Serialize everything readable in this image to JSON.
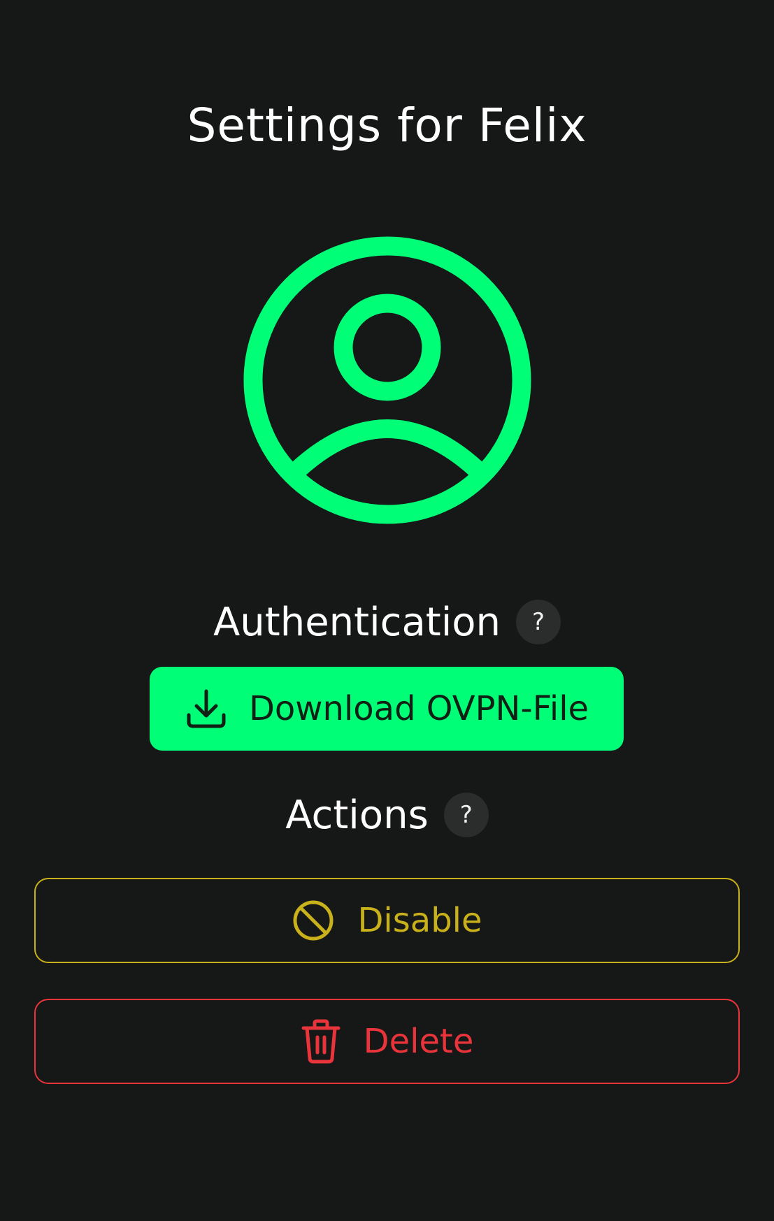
{
  "header": {
    "title": "Settings for Felix"
  },
  "avatar": {
    "icon": "user-circle-icon",
    "color": "#00ff77"
  },
  "authentication": {
    "heading": "Authentication",
    "help_label": "?",
    "download_button_label": "Download OVPN-File",
    "download_icon": "download-icon",
    "accent": "#00ff77"
  },
  "actions": {
    "heading": "Actions",
    "help_label": "?",
    "disable": {
      "label": "Disable",
      "icon": "ban-icon",
      "color": "#c8b11a"
    },
    "delete": {
      "label": "Delete",
      "icon": "trash-icon",
      "color": "#e8343a"
    }
  },
  "colors": {
    "background": "#161717",
    "help_badge": "#2b2c2c"
  }
}
